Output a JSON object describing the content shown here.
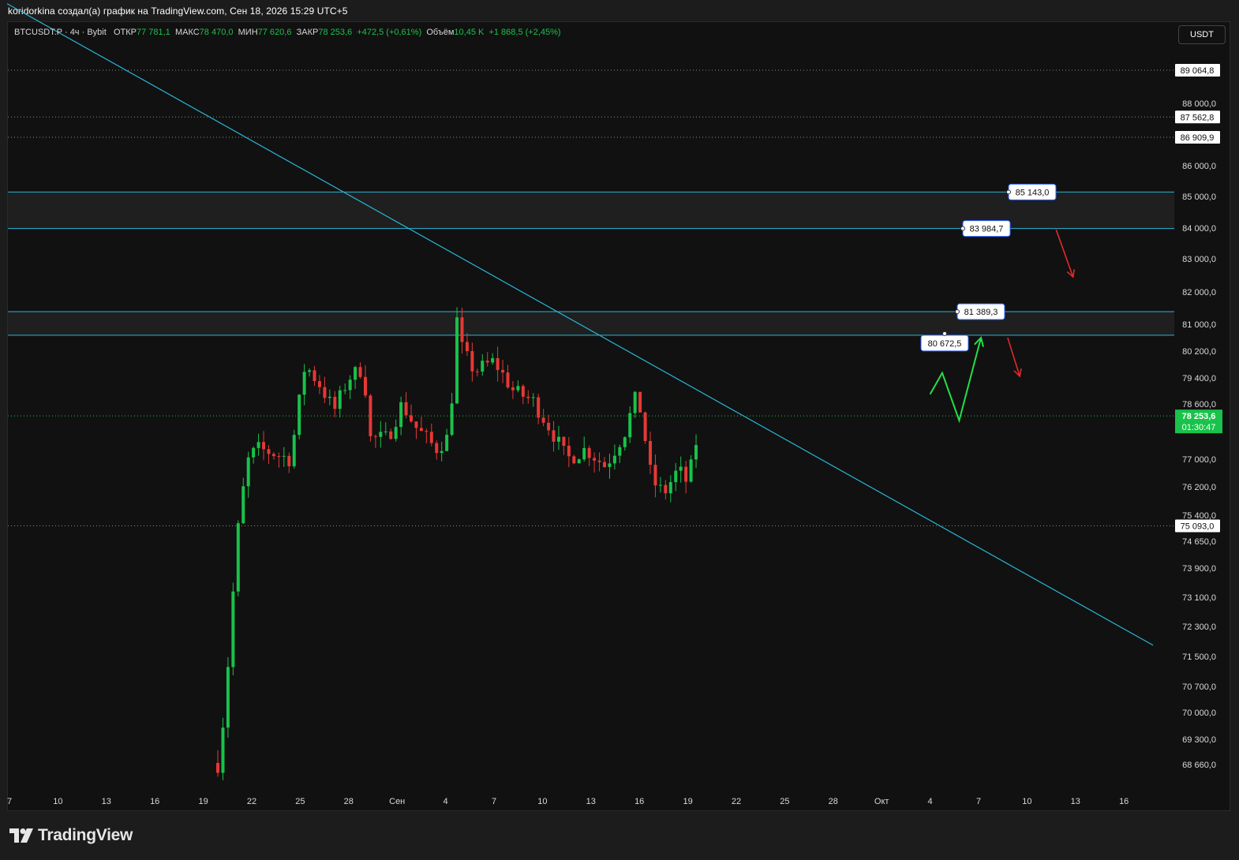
{
  "caption": "koridorkina создал(а) график на TradingView.com, Сен 18, 2026 15:29 UTC+5",
  "legend": {
    "symbol": "BTCUSDT.P · 4ч · Bybit",
    "open_label": "ОТКР",
    "open_value": "77 781,1",
    "high_label": "МАКС",
    "high_value": "78 470,0",
    "low_label": "МИН",
    "low_value": "77 620,6",
    "close_label": "ЗАКР",
    "close_value": "78 253,6",
    "change": "+472,5 (+0,61%)",
    "volume_label": "Объём",
    "volume_value": "10,45 K",
    "volume_change": "+1 868,5 (+2,45%)"
  },
  "currency_button": "USDT",
  "branding": "TradingView",
  "colors": {
    "up": "#19c24a",
    "down": "#e53935",
    "trendline": "#29b6d8",
    "zone_line": "#29b6d8",
    "background": "#111111",
    "arrow_up": "#22e04a",
    "arrow_down": "#e02a2a"
  },
  "chart_data": {
    "type": "candlestick",
    "symbol": "BTCUSDT.P",
    "timeframe": "4ч",
    "exchange": "Bybit",
    "current_price": "78 253,6",
    "countdown": "01:30:47",
    "y_ticks": [
      {
        "value": 88000,
        "label": "88 000,0"
      },
      {
        "value": 86000,
        "label": "86 000,0"
      },
      {
        "value": 85000,
        "label": "85 000,0"
      },
      {
        "value": 84000,
        "label": "84 000,0"
      },
      {
        "value": 83000,
        "label": "83 000,0"
      },
      {
        "value": 82000,
        "label": "82 000,0"
      },
      {
        "value": 81000,
        "label": "81 000,0"
      },
      {
        "value": 80200,
        "label": "80 200,0"
      },
      {
        "value": 79400,
        "label": "79 400,0"
      },
      {
        "value": 78600,
        "label": "78 600,0"
      },
      {
        "value": 77000,
        "label": "77 000,0"
      },
      {
        "value": 76200,
        "label": "76 200,0"
      },
      {
        "value": 75400,
        "label": "75 400,0"
      },
      {
        "value": 74650,
        "label": "74 650,0"
      },
      {
        "value": 73900,
        "label": "73 900,0"
      },
      {
        "value": 73100,
        "label": "73 100,0"
      },
      {
        "value": 72300,
        "label": "72 300,0"
      },
      {
        "value": 71500,
        "label": "71 500,0"
      },
      {
        "value": 70700,
        "label": "70 700,0"
      },
      {
        "value": 70000,
        "label": "70 000,0"
      },
      {
        "value": 69300,
        "label": "69 300,0"
      },
      {
        "value": 68660,
        "label": "68 660,0"
      }
    ],
    "x_ticks": [
      "7",
      "10",
      "13",
      "16",
      "19",
      "22",
      "25",
      "28",
      "Сен",
      "4",
      "7",
      "10",
      "13",
      "16",
      "19",
      "22",
      "25",
      "28",
      "Окт",
      "4",
      "7",
      "10",
      "13",
      "16"
    ],
    "dotted_levels": [
      {
        "value": 89064.8,
        "label": "89 064,8"
      },
      {
        "value": 87562.8,
        "label": "87 562,8"
      },
      {
        "value": 86909.9,
        "label": "86 909,9"
      },
      {
        "value": 75093.0,
        "label": "75 093,0"
      }
    ],
    "zones": [
      {
        "top": 85143.0,
        "bottom": 83984.7,
        "top_label": "85 143,0",
        "bottom_label": "83 984,7"
      },
      {
        "top": 81389.3,
        "bottom": 80672.5,
        "top_label": "81 389,3",
        "bottom_label": "80 672,5"
      }
    ],
    "trendline": {
      "start": {
        "x_index": -0.05,
        "price": 91200
      },
      "end": {
        "x_index": 23.6,
        "price": 71800
      }
    },
    "projection_path": [
      {
        "x_index": 19.0,
        "price": 78900
      },
      {
        "x_index": 19.25,
        "price": 79550
      },
      {
        "x_index": 19.6,
        "price": 78120
      },
      {
        "x_index": 20.05,
        "price": 80600
      }
    ],
    "down_arrows": [
      {
        "x1": 20.6,
        "p1": 80600,
        "x2": 20.85,
        "p2": 79450
      },
      {
        "x1": 21.6,
        "p1": 83950,
        "x2": 21.95,
        "p2": 82450
      }
    ]
  }
}
